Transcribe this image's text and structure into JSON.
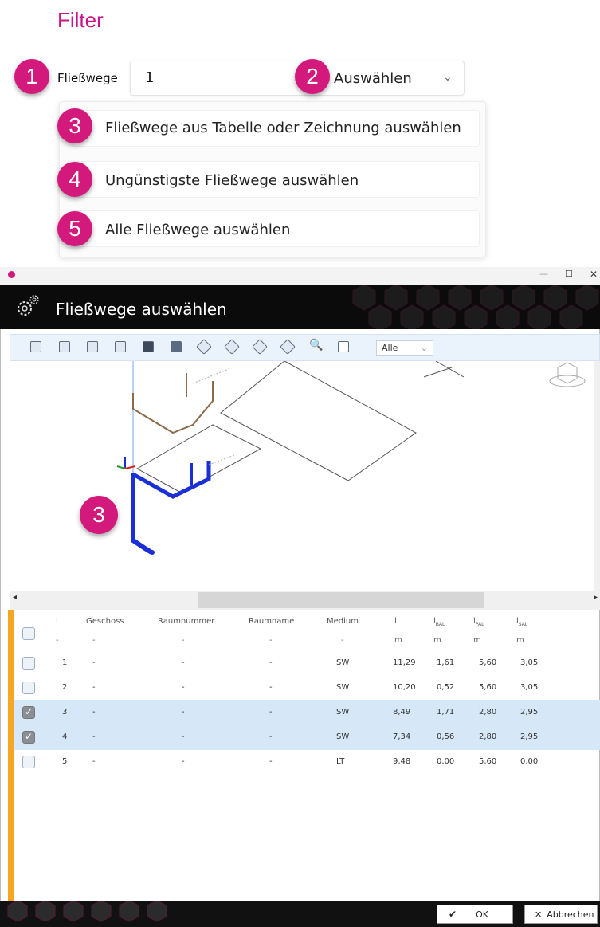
{
  "filter": {
    "title": "Filter",
    "label": "Fließwege",
    "input_value": "1",
    "select_value": "Auswählen"
  },
  "badges": [
    "1",
    "2",
    "3",
    "4",
    "5"
  ],
  "menu": {
    "items": [
      "Fließwege aus Tabelle oder Zeichnung auswählen",
      "Ungünstigste Fließwege auswählen",
      "Alle Fließwege auswählen"
    ]
  },
  "dialog": {
    "title": "Fließwege auswählen",
    "view_dropdown": "Alle",
    "viewport_badge": "3",
    "columns": [
      "l",
      "Geschoss",
      "Raumnummer",
      "Raumname",
      "Medium",
      "l",
      "l",
      "l",
      "l"
    ],
    "column_subs": [
      "",
      "",
      "",
      "",
      "",
      "",
      "BAL",
      "PAL",
      "SAL"
    ],
    "units": [
      "-",
      "-",
      "-",
      "-",
      "-",
      "m",
      "m",
      "m",
      "m"
    ],
    "rows": [
      {
        "checked": false,
        "values": [
          "1",
          "-",
          "-",
          "-",
          "SW",
          "11,29",
          "1,61",
          "5,60",
          "3,05"
        ]
      },
      {
        "checked": false,
        "values": [
          "2",
          "-",
          "-",
          "-",
          "SW",
          "10,20",
          "0,52",
          "5,60",
          "3,05"
        ]
      },
      {
        "checked": true,
        "values": [
          "3",
          "-",
          "-",
          "-",
          "SW",
          "8,49",
          "1,71",
          "2,80",
          "2,95"
        ]
      },
      {
        "checked": true,
        "values": [
          "4",
          "-",
          "-",
          "-",
          "SW",
          "7,34",
          "0,56",
          "2,80",
          "2,95"
        ]
      },
      {
        "checked": false,
        "values": [
          "5",
          "-",
          "-",
          "-",
          "LT",
          "9,48",
          "0,00",
          "5,60",
          "0,00"
        ]
      }
    ],
    "ok_label": "OK",
    "cancel_label": "Abbrechen"
  },
  "colors": {
    "accent": "#c71585",
    "badge": "#d4197c",
    "selection": "#d6e8f7",
    "pipe_active": "#1a2fd6",
    "pipe": "#8b6a4a"
  }
}
